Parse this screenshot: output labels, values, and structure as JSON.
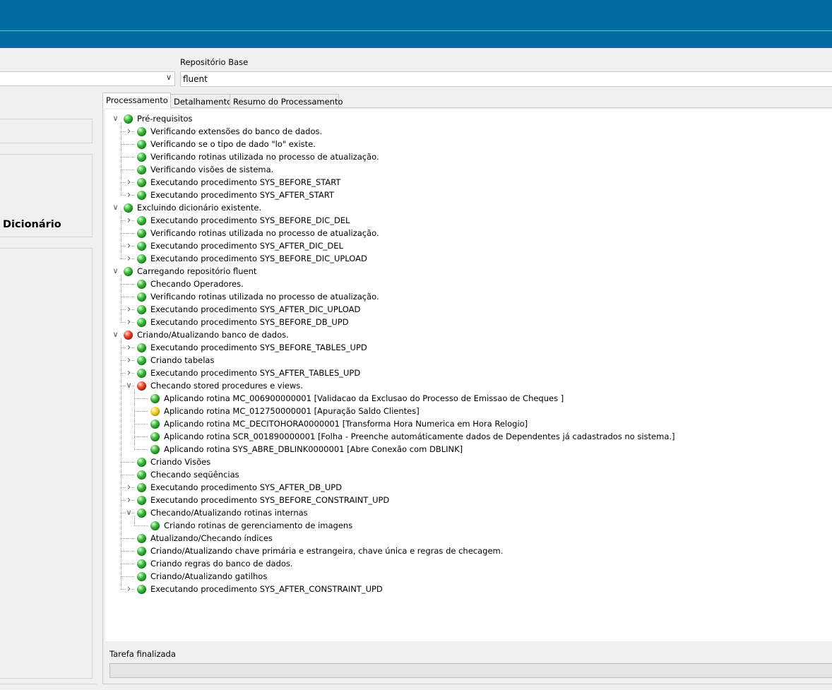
{
  "header": {
    "repository_label": "Repositório Base",
    "repository_value": "fluent",
    "combo_value": ""
  },
  "left": {
    "dictionary_label": "Dicionário"
  },
  "tabs": [
    {
      "label": "Processamento",
      "active": true
    },
    {
      "label": "Detalhamento",
      "active": false
    },
    {
      "label": "Resumo do Processamento",
      "active": false
    }
  ],
  "tree": [
    {
      "level": 0,
      "status": "green",
      "expander": "expanded",
      "label": "Pré-requisitos"
    },
    {
      "level": 1,
      "status": "green",
      "expander": "collapsed",
      "label": "Verificando extensões do banco de dados."
    },
    {
      "level": 1,
      "status": "green",
      "expander": "none",
      "label": "Verificando se o tipo de dado \"lo\" existe."
    },
    {
      "level": 1,
      "status": "green",
      "expander": "none",
      "label": "Verificando rotinas utilizada no processo de atualização."
    },
    {
      "level": 1,
      "status": "green",
      "expander": "none",
      "label": "Verificando visões de sistema."
    },
    {
      "level": 1,
      "status": "green",
      "expander": "collapsed",
      "label": "Executando procedimento SYS_BEFORE_START"
    },
    {
      "level": 1,
      "status": "green",
      "expander": "collapsed",
      "label": "Executando procedimento SYS_AFTER_START"
    },
    {
      "level": 0,
      "status": "green",
      "expander": "expanded",
      "label": "Excluindo dicionário existente."
    },
    {
      "level": 1,
      "status": "green",
      "expander": "collapsed",
      "label": "Executando procedimento SYS_BEFORE_DIC_DEL"
    },
    {
      "level": 1,
      "status": "green",
      "expander": "none",
      "label": "Verificando rotinas utilizada no processo de atualização."
    },
    {
      "level": 1,
      "status": "green",
      "expander": "collapsed",
      "label": "Executando procedimento SYS_AFTER_DIC_DEL"
    },
    {
      "level": 1,
      "status": "green",
      "expander": "collapsed",
      "label": "Executando procedimento SYS_BEFORE_DIC_UPLOAD"
    },
    {
      "level": 0,
      "status": "green",
      "expander": "expanded",
      "label": "Carregando repositório fluent"
    },
    {
      "level": 1,
      "status": "green",
      "expander": "none",
      "label": "Checando Operadores."
    },
    {
      "level": 1,
      "status": "green",
      "expander": "none",
      "label": "Verificando rotinas utilizada no processo de atualização."
    },
    {
      "level": 1,
      "status": "green",
      "expander": "collapsed",
      "label": "Executando procedimento SYS_AFTER_DIC_UPLOAD"
    },
    {
      "level": 1,
      "status": "green",
      "expander": "collapsed",
      "label": "Executando procedimento SYS_BEFORE_DB_UPD"
    },
    {
      "level": 0,
      "status": "red",
      "expander": "expanded",
      "label": "Criando/Atualizando banco de dados."
    },
    {
      "level": 1,
      "status": "green",
      "expander": "collapsed",
      "label": "Executando procedimento SYS_BEFORE_TABLES_UPD"
    },
    {
      "level": 1,
      "status": "green",
      "expander": "collapsed",
      "label": "Criando tabelas"
    },
    {
      "level": 1,
      "status": "green",
      "expander": "collapsed",
      "label": "Executando procedimento SYS_AFTER_TABLES_UPD"
    },
    {
      "level": 1,
      "status": "red",
      "expander": "expanded",
      "label": "Checando stored procedures e views."
    },
    {
      "level": 2,
      "status": "green",
      "expander": "none",
      "label": "Aplicando rotina MC_006900000001 [Validacao  da Exclusao do Processo de Emissao de Cheques  ]"
    },
    {
      "level": 2,
      "status": "yellow",
      "expander": "none",
      "label": "Aplicando rotina MC_012750000001 [Apuração Saldo Clientes]"
    },
    {
      "level": 2,
      "status": "green",
      "expander": "none",
      "label": "Aplicando rotina MC_DECITOHORA0000001 [Transforma Hora Numerica em Hora Relogio]"
    },
    {
      "level": 2,
      "status": "green",
      "expander": "none",
      "label": "Aplicando rotina SCR_001890000001 [Folha - Preenche automáticamente dados de Dependentes já cadastrados no sistema.]"
    },
    {
      "level": 2,
      "status": "green",
      "expander": "none",
      "label": "Aplicando rotina SYS_ABRE_DBLINK0000001 [Abre Conexão com DBLINK]"
    },
    {
      "level": 1,
      "status": "green",
      "expander": "none",
      "label": "Criando Visões"
    },
    {
      "level": 1,
      "status": "green",
      "expander": "none",
      "label": "Checando seqüências"
    },
    {
      "level": 1,
      "status": "green",
      "expander": "collapsed",
      "label": "Executando procedimento SYS_AFTER_DB_UPD"
    },
    {
      "level": 1,
      "status": "green",
      "expander": "collapsed",
      "label": "Executando procedimento SYS_BEFORE_CONSTRAINT_UPD"
    },
    {
      "level": 1,
      "status": "green",
      "expander": "expanded",
      "label": "Checando/Atualizando rotinas internas"
    },
    {
      "level": 2,
      "status": "green",
      "expander": "none",
      "label": "Criando rotinas de gerenciamento de imagens"
    },
    {
      "level": 1,
      "status": "green",
      "expander": "none",
      "label": "Atualizando/Checando índices"
    },
    {
      "level": 1,
      "status": "green",
      "expander": "none",
      "label": "Criando/Atualizando chave primária e estrangeira, chave única e regras de checagem."
    },
    {
      "level": 1,
      "status": "green",
      "expander": "none",
      "label": "Criando regras do banco de dados."
    },
    {
      "level": 1,
      "status": "green",
      "expander": "none",
      "label": "Criando/Atualizando gatilhos"
    },
    {
      "level": 1,
      "status": "green",
      "expander": "collapsed",
      "label": "Executando procedimento SYS_AFTER_CONSTRAINT_UPD"
    }
  ],
  "status": {
    "text": "Tarefa finalizada",
    "progress": 0
  },
  "colors": {
    "titlebar": "#006aa1",
    "green": "#2fb02f",
    "red": "#e5391e",
    "yellow": "#f2cf1a"
  }
}
